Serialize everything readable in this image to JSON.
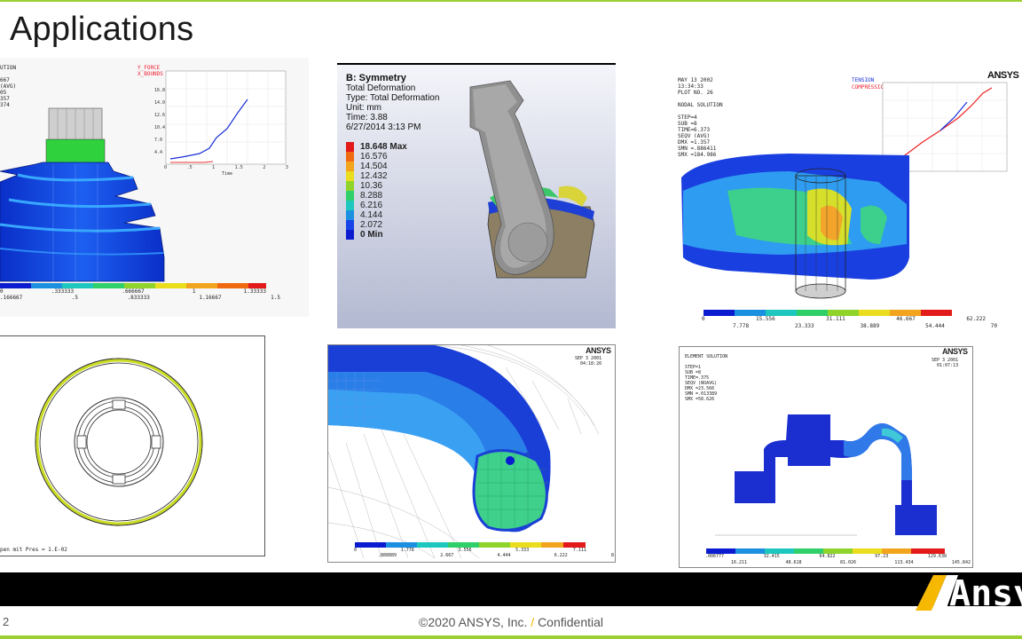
{
  "slide": {
    "title": "Applications",
    "page_number": "2",
    "footer_copyright": "©2020 ANSYS, Inc.",
    "footer_sep": "/",
    "footer_confidential": "Confidential",
    "brand_name": "Ansys"
  },
  "panel1": {
    "info_lines": [
      "UTION",
      "",
      "667",
      "(AVG)",
      "05",
      "357",
      "374"
    ],
    "legend_top": [
      "0",
      ".333333",
      ".666667",
      "1",
      "1.33333"
    ],
    "legend_bottom": [
      ".166667",
      ".5",
      ".833333",
      "1.16667",
      "1.5"
    ],
    "chart_legend_1": "Y_FORCE",
    "chart_legend_2": "X_BOUNDS",
    "y_ticks": [
      "16.8",
      "14.0",
      "12.6",
      "10.4",
      "7.0",
      "4.4"
    ],
    "x_ticks": [
      "0",
      ".5",
      "1",
      "1.5",
      "2",
      "3"
    ],
    "x_label": "Time"
  },
  "panel2": {
    "name": "B: Symmetry",
    "type": "Total Deformation",
    "type_line": "Type: Total Deformation",
    "unit": "Unit: mm",
    "time": "Time: 3.88",
    "date": "6/27/2014 3:13 PM",
    "legend": [
      "18.648 Max",
      "16.576",
      "14.504",
      "12.432",
      "10.36",
      "8.288",
      "6.216",
      "4.144",
      "2.072",
      "0 Min"
    ],
    "colors": [
      "#e21a1a",
      "#f06a12",
      "#f2a41c",
      "#eadd1e",
      "#8fd42a",
      "#2fcf6a",
      "#1ec7bd",
      "#1b8fe0",
      "#1644e6",
      "#0a1bd0"
    ]
  },
  "panel3": {
    "brand": "ANSYS",
    "info_lines": [
      "MAY 13 2002",
      "13:34:33",
      "PLOT NO.  26",
      "NODAL SOLUTION",
      "STEP=4",
      "SUB =8",
      "TIME=6.373",
      "SEQV     (AVG)",
      "DMX =1.357",
      "SMN =.886411",
      "SMX =184.986"
    ],
    "chart_legend_1": "TENSION",
    "chart_legend_2": "COMPRESSION",
    "legend_top": [
      "0",
      "15.556",
      "31.111",
      "46.667",
      "62.222"
    ],
    "legend_bottom": [
      "7.778",
      "23.333",
      "38.889",
      "54.444",
      "70"
    ]
  },
  "panel4": {
    "caption": "pen mit Pres = 1.E-02"
  },
  "panel5": {
    "brand": "ANSYS",
    "date": "SEP  3 2001",
    "time": "04:18:26",
    "legend_top": [
      "0",
      "1.778",
      "3.556",
      "5.333",
      "7.111"
    ],
    "legend_bottom": [
      ".888889",
      "2.667",
      "4.444",
      "6.222",
      "8"
    ]
  },
  "panel6": {
    "brand": "ANSYS",
    "date": "SEP  3 2001",
    "time": "01:07:13",
    "info_lines": [
      "ELEMENT SOLUTION",
      "",
      "STEP=1",
      "SUB =8",
      "TIME=.375",
      "SEQV     (NOAVG)",
      "DMX =23.566",
      "SMN =.013389",
      "SMX =58.626"
    ],
    "legend_top": [
      ".006777",
      "32.415",
      "64.822",
      "97.23",
      "129.638"
    ],
    "legend_bottom": [
      "16.211",
      "48.618",
      "81.026",
      "113.434",
      "145.842"
    ]
  }
}
